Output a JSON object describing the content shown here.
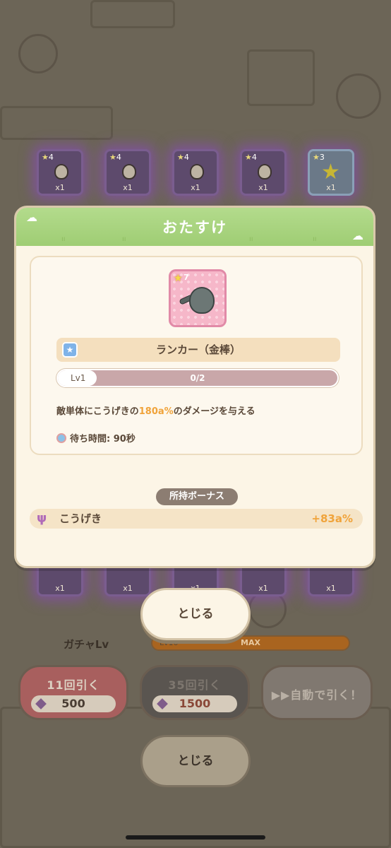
{
  "top_cards": [
    {
      "stars": "4",
      "count": "x1",
      "kind": "face-icon"
    },
    {
      "stars": "4",
      "count": "x1",
      "kind": "face-icon"
    },
    {
      "stars": "4",
      "count": "x1",
      "kind": "face-icon"
    },
    {
      "stars": "4",
      "count": "x1",
      "kind": "face-icon"
    },
    {
      "stars": "3",
      "count": "x1",
      "kind": "star-icon"
    }
  ],
  "bottom_cards": [
    {
      "count": "x1"
    },
    {
      "count": "x1"
    },
    {
      "count": "x1"
    },
    {
      "count": "x1"
    },
    {
      "count": "x1"
    }
  ],
  "modal": {
    "title": "おたすけ",
    "unit": {
      "stars": "7",
      "name": "ランカー（金棒）"
    },
    "level": {
      "label": "Lv1",
      "progress_text": "0/2",
      "progress_fraction": 0.14
    },
    "description": {
      "prefix": "敵単体にこうげきの",
      "highlight": "180a%",
      "suffix": "のダメージを与える"
    },
    "wait_time": "待ち時間: 90秒",
    "bonus_title": "所持ボーナス",
    "bonus": {
      "name": "こうげき",
      "value": "+83a%"
    },
    "close_label": "とじる"
  },
  "background": {
    "gacha_label": "ガチャLv",
    "gacha_level": "Lv10",
    "gacha_max": "MAX",
    "draw_11": {
      "label": "11回引く",
      "price": "500"
    },
    "draw_35": {
      "label": "35回引く",
      "price": "1500"
    },
    "auto_draw": "▶▶自動で引く！",
    "close_label": "とじる"
  },
  "colors": {
    "header_green": "#9fcd74",
    "highlight_orange": "#f0a33a",
    "card_pink": "#f6b7c9"
  }
}
